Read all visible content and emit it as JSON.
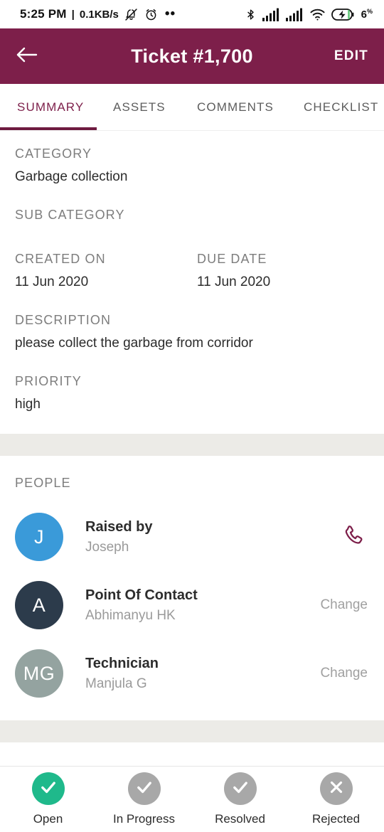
{
  "statusbar": {
    "time": "5:25  PM",
    "separator": "|",
    "network_speed": "0.1KB/s",
    "silent_icon": "bell-muted-icon",
    "alarm_icon": "alarm-clock-icon",
    "more_icon": "more-dots-icon",
    "bluetooth_icon": "bluetooth-icon",
    "signal1_icon": "signal-bars-icon",
    "signal2_icon": "signal-bars-icon",
    "wifi_icon": "wifi-icon",
    "battery_icon": "battery-charging-icon",
    "battery_level": "6",
    "battery_unit": "%"
  },
  "appbar": {
    "back_icon": "back-arrow-icon",
    "title": "Ticket #1,700",
    "edit_label": "EDIT",
    "color": "#7d1f4a"
  },
  "tabs": {
    "items": [
      {
        "label": "SUMMARY",
        "active": true
      },
      {
        "label": "ASSETS",
        "active": false
      },
      {
        "label": "COMMENTS",
        "active": false
      },
      {
        "label": "CHECKLIST",
        "active": false
      }
    ],
    "active_color": "#7d1f4a",
    "inactive_color": "#5d5d5d"
  },
  "summary": {
    "category": {
      "label": "CATEGORY",
      "value": "Garbage collection"
    },
    "sub_category": {
      "label": "SUB CATEGORY",
      "value": ""
    },
    "created_on": {
      "label": "CREATED ON",
      "value": "11 Jun 2020"
    },
    "due_date": {
      "label": "DUE DATE",
      "value": "11 Jun 2020"
    },
    "description": {
      "label": "DESCRIPTION",
      "value": "please collect the garbage from corridor"
    },
    "priority": {
      "label": "PRIORITY",
      "value": "high"
    }
  },
  "people": {
    "title": "PEOPLE",
    "items": [
      {
        "initials": "J",
        "avatar_color": "#3a9ad9",
        "role": "Raised by",
        "name": "Joseph",
        "action": "",
        "call_icon": "phone-icon"
      },
      {
        "initials": "A",
        "avatar_color": "#2c3b4b",
        "role": "Point Of Contact",
        "name": "Abhimanyu HK",
        "action": "Change",
        "call_icon": ""
      },
      {
        "initials": "MG",
        "avatar_color": "#94a3a0",
        "role": "Technician",
        "name": "Manjula G",
        "action": "Change",
        "call_icon": ""
      }
    ]
  },
  "bottom_status": {
    "items": [
      {
        "label": "Open",
        "icon": "check-icon",
        "active": true
      },
      {
        "label": "In Progress",
        "icon": "check-icon",
        "active": false
      },
      {
        "label": "Resolved",
        "icon": "check-icon",
        "active": false
      },
      {
        "label": "Rejected",
        "icon": "close-icon",
        "active": false
      }
    ],
    "active_color": "#1fb98b",
    "inactive_color": "#a8a8a8"
  }
}
